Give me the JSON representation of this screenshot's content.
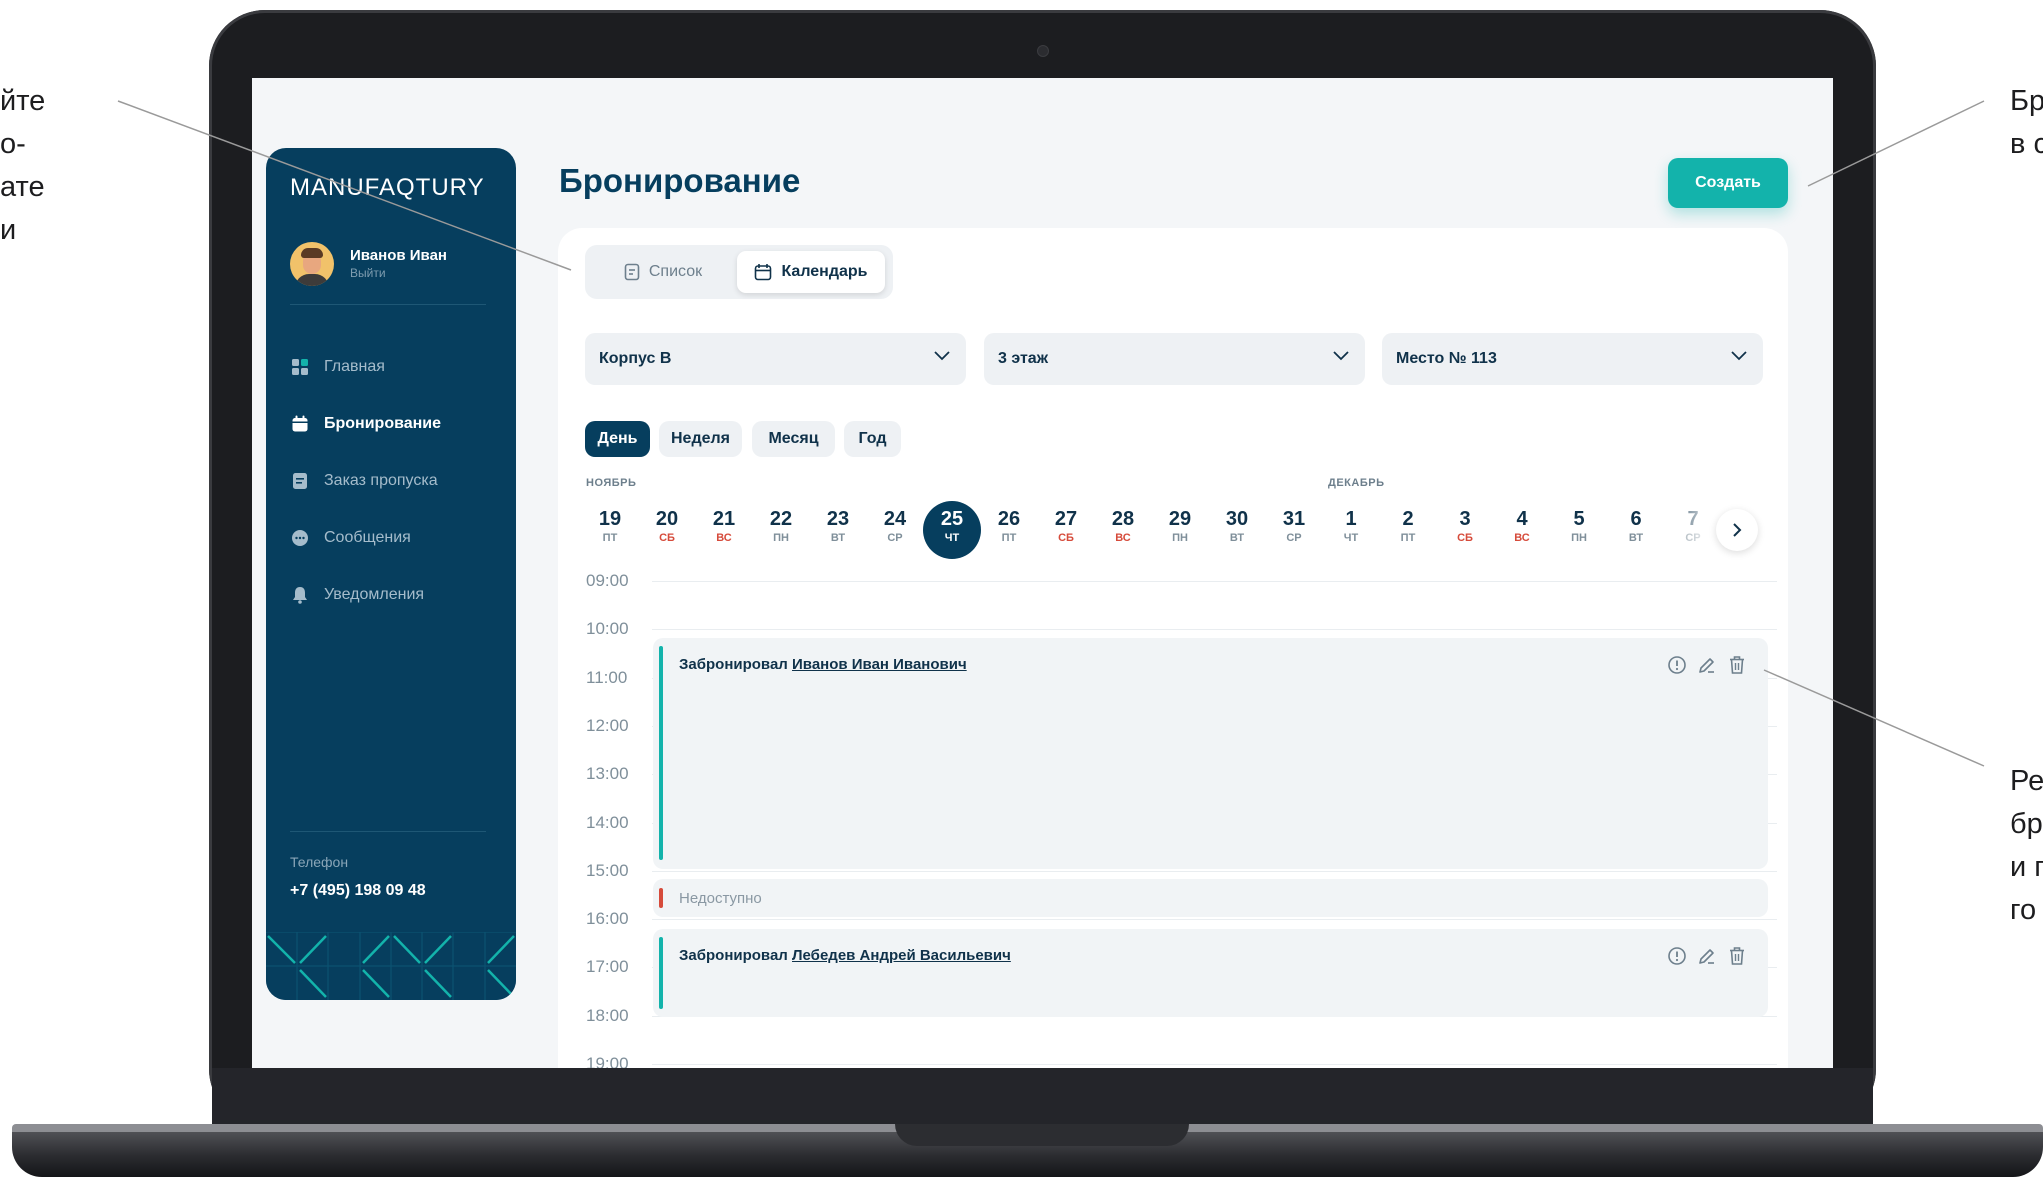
{
  "annotations": {
    "left": [
      "йте",
      "о-",
      "ате",
      "и"
    ],
    "right_top": [
      "Бр",
      "в с"
    ],
    "right_bottom": [
      "Ре",
      "бр",
      "и п",
      "го"
    ]
  },
  "sidebar": {
    "logo": "MANUFAQTURY",
    "user": {
      "name": "Иванов Иван",
      "logout": "Выйти"
    },
    "items": [
      {
        "label": "Главная",
        "icon": "grid-icon",
        "active": false
      },
      {
        "label": "Бронирование",
        "icon": "calendar-icon",
        "active": true
      },
      {
        "label": "Заказ пропуска",
        "icon": "document-icon",
        "active": false
      },
      {
        "label": "Сообщения",
        "icon": "chat-icon",
        "active": false
      },
      {
        "label": "Уведомления",
        "icon": "bell-icon",
        "active": false
      }
    ],
    "phone_label": "Телефон",
    "phone": "+7 (495) 198 09 48"
  },
  "header": {
    "title": "Бронирование",
    "create_label": "Создать"
  },
  "view_switch": {
    "list": "Список",
    "calendar": "Календарь",
    "active": "calendar"
  },
  "filters": {
    "building": "Корпус В",
    "floor": "3 этаж",
    "place": "Место № 113"
  },
  "periods": {
    "day": "День",
    "week": "Неделя",
    "month": "Месяц",
    "year": "Год",
    "active": "day"
  },
  "months": {
    "first": "НОЯБРЬ",
    "second": "ДЕКАБРЬ"
  },
  "days": [
    {
      "num": "19",
      "dow": "ПТ",
      "weekend": false
    },
    {
      "num": "20",
      "dow": "СБ",
      "weekend": true
    },
    {
      "num": "21",
      "dow": "ВС",
      "weekend": true
    },
    {
      "num": "22",
      "dow": "ПН",
      "weekend": false
    },
    {
      "num": "23",
      "dow": "ВТ",
      "weekend": false
    },
    {
      "num": "24",
      "dow": "СР",
      "weekend": false
    },
    {
      "num": "25",
      "dow": "ЧТ",
      "weekend": false,
      "selected": true
    },
    {
      "num": "26",
      "dow": "ПТ",
      "weekend": false
    },
    {
      "num": "27",
      "dow": "СБ",
      "weekend": true
    },
    {
      "num": "28",
      "dow": "ВС",
      "weekend": true
    },
    {
      "num": "29",
      "dow": "ПН",
      "weekend": false
    },
    {
      "num": "30",
      "dow": "ВТ",
      "weekend": false
    },
    {
      "num": "31",
      "dow": "СР",
      "weekend": false
    },
    {
      "num": "1",
      "dow": "ЧТ",
      "weekend": false
    },
    {
      "num": "2",
      "dow": "ПТ",
      "weekend": false
    },
    {
      "num": "3",
      "dow": "СБ",
      "weekend": true
    },
    {
      "num": "4",
      "dow": "ВС",
      "weekend": true
    },
    {
      "num": "5",
      "dow": "ПН",
      "weekend": false
    },
    {
      "num": "6",
      "dow": "ВТ",
      "weekend": false
    },
    {
      "num": "7",
      "dow": "СР",
      "weekend": false
    }
  ],
  "times": [
    "09:00",
    "10:00",
    "11:00",
    "12:00",
    "13:00",
    "14:00",
    "15:00",
    "16:00",
    "17:00",
    "18:00",
    "19:00"
  ],
  "bookings": [
    {
      "prefix": "Забронировал",
      "person": "Иванов Иван Иванович"
    },
    {
      "prefix": "Забронировал",
      "person": "Лебедев Андрей Васильевич"
    }
  ],
  "unavailable": "Недоступно",
  "colors": {
    "navy": "#063e5e",
    "teal": "#13b3ab",
    "weekend_red": "#d64b3b"
  }
}
